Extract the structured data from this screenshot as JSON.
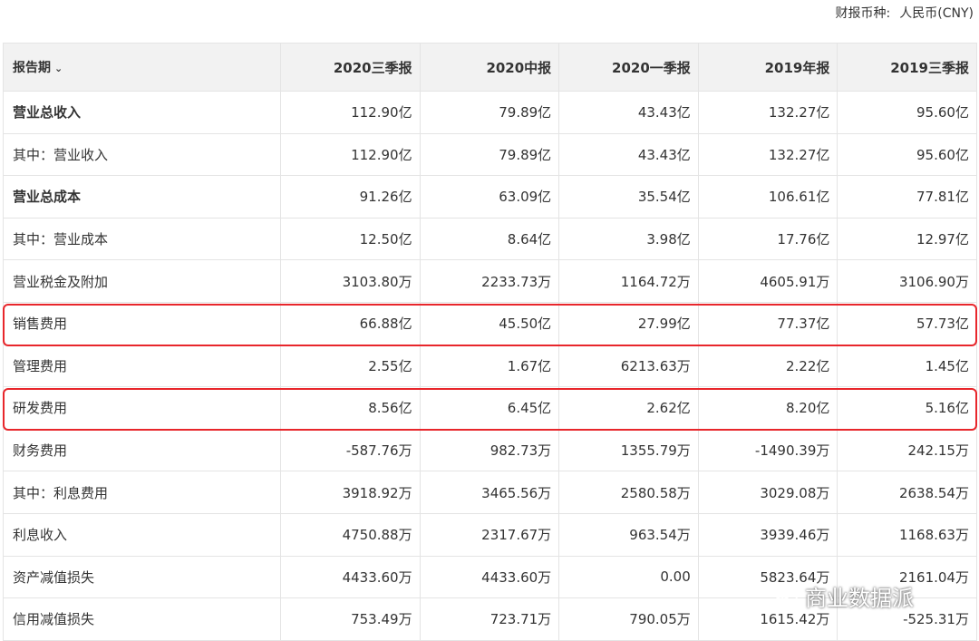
{
  "currency": {
    "label": "财报币种:",
    "value": "人民币(CNY)"
  },
  "table": {
    "period_header": "报告期",
    "columns": [
      "2020三季报",
      "2020中报",
      "2020一季报",
      "2019年报",
      "2019三季报"
    ],
    "rows": [
      {
        "label": "营业总收入",
        "bold": true,
        "values": [
          "112.90亿",
          "79.89亿",
          "43.43亿",
          "132.27亿",
          "95.60亿"
        ]
      },
      {
        "label": "其中：营业收入",
        "bold": false,
        "values": [
          "112.90亿",
          "79.89亿",
          "43.43亿",
          "132.27亿",
          "95.60亿"
        ]
      },
      {
        "label": "营业总成本",
        "bold": true,
        "values": [
          "91.26亿",
          "63.09亿",
          "35.54亿",
          "106.61亿",
          "77.81亿"
        ]
      },
      {
        "label": "其中：营业成本",
        "bold": false,
        "values": [
          "12.50亿",
          "8.64亿",
          "3.98亿",
          "17.76亿",
          "12.97亿"
        ]
      },
      {
        "label": "营业税金及附加",
        "bold": false,
        "values": [
          "3103.80万",
          "2233.73万",
          "1164.72万",
          "4605.91万",
          "3106.90万"
        ]
      },
      {
        "label": "销售费用",
        "bold": false,
        "values": [
          "66.88亿",
          "45.50亿",
          "27.99亿",
          "77.37亿",
          "57.73亿"
        ]
      },
      {
        "label": "管理费用",
        "bold": false,
        "values": [
          "2.55亿",
          "1.67亿",
          "6213.63万",
          "2.22亿",
          "1.45亿"
        ]
      },
      {
        "label": "研发费用",
        "bold": false,
        "values": [
          "8.56亿",
          "6.45亿",
          "2.62亿",
          "8.20亿",
          "5.16亿"
        ]
      },
      {
        "label": "财务费用",
        "bold": false,
        "values": [
          "-587.76万",
          "982.73万",
          "1355.79万",
          "-1490.39万",
          "242.15万"
        ]
      },
      {
        "label": "其中：利息费用",
        "bold": false,
        "values": [
          "3918.92万",
          "3465.56万",
          "2580.58万",
          "3029.08万",
          "2638.54万"
        ]
      },
      {
        "label": "利息收入",
        "bold": false,
        "values": [
          "4750.88万",
          "2317.67万",
          "963.54万",
          "3939.46万",
          "1168.63万"
        ]
      },
      {
        "label": "资产减值损失",
        "bold": false,
        "values": [
          "4433.60万",
          "4433.60万",
          "0.00",
          "5823.64万",
          "2161.04万"
        ]
      },
      {
        "label": "信用减值损失",
        "bold": false,
        "values": [
          "753.49万",
          "723.71万",
          "790.05万",
          "1615.42万",
          "-525.31万"
        ]
      }
    ]
  },
  "highlight_color": "#e8262b",
  "watermark": {
    "text": "商业数据派",
    "icon": "wechat-icon"
  }
}
